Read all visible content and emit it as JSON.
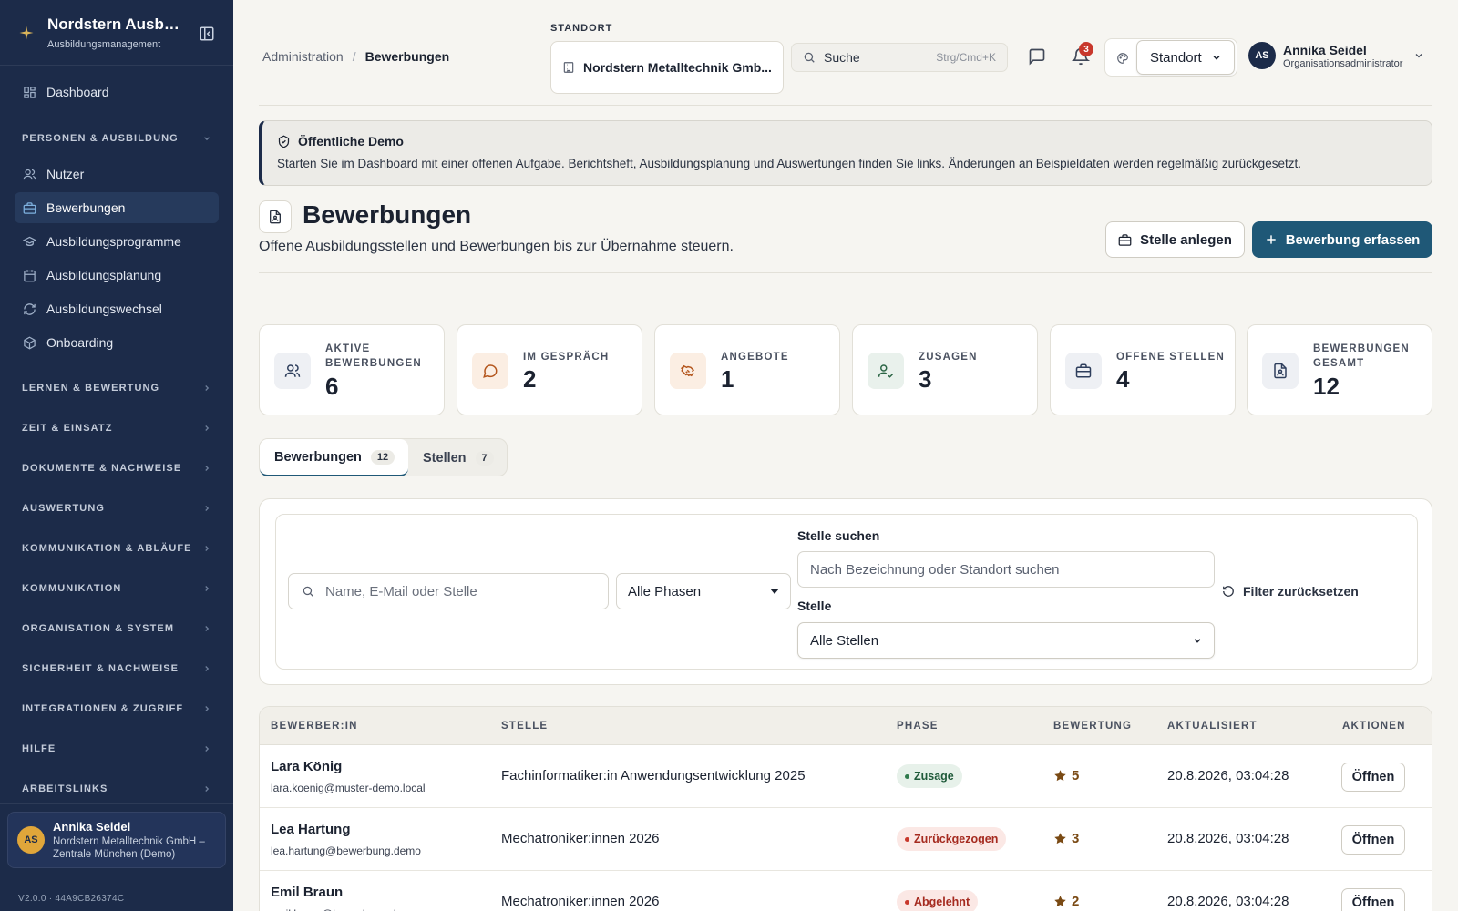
{
  "colors": {
    "sidebar_bg": "#1c2b49",
    "primary": "#1f5877",
    "accent_gold": "#e0a63a",
    "success_pill": "#e7f1ea",
    "danger_pill": "#fbe8e5"
  },
  "sidebar": {
    "brand_title": "Nordstern Ausbil...",
    "brand_subtitle": "Ausbildungsmanagement",
    "dashboard": "Dashboard",
    "group_open": "PERSONEN & AUSBILDUNG",
    "sub_items": [
      {
        "label": "Nutzer",
        "icon": "users-icon"
      },
      {
        "label": "Bewerbungen",
        "icon": "briefcase-icon",
        "active": true
      },
      {
        "label": "Ausbildungsprogramme",
        "icon": "graduation-cap-icon"
      },
      {
        "label": "Ausbildungsplanung",
        "icon": "calendar-icon"
      },
      {
        "label": "Ausbildungswechsel",
        "icon": "refresh-icon"
      },
      {
        "label": "Onboarding",
        "icon": "package-icon"
      }
    ],
    "groups": [
      "LERNEN & BEWERTUNG",
      "ZEIT & EINSATZ",
      "DOKUMENTE & NACHWEISE",
      "AUSWERTUNG",
      "KOMMUNIKATION & ABLÄUFE",
      "KOMMUNIKATION",
      "ORGANISATION & SYSTEM",
      "SICHERHEIT & NACHWEISE",
      "INTEGRATIONEN & ZUGRIFF",
      "HILFE",
      "ARBEITSLINKS"
    ],
    "user": {
      "initials": "AS",
      "name": "Annika Seidel",
      "org_line1": "Nordstern Metalltechnik GmbH –",
      "org_line2": "Zentrale München (Demo)"
    },
    "version": "V2.0.0 · 44A9CB26374C"
  },
  "header": {
    "breadcrumb": [
      "Administration",
      "Bewerbungen"
    ],
    "breadcrumb_sep": "/",
    "standort_label": "STANDORT",
    "standort_value": "Nordstern Metalltechnik Gmb...",
    "search_placeholder": "Suche",
    "search_shortcut": "Strg/Cmd+K",
    "notification_count": "3",
    "theme_select": "Standort",
    "user": {
      "initials": "AS",
      "name": "Annika Seidel",
      "role": "Organisationsadministrator"
    }
  },
  "notice": {
    "title": "Öffentliche Demo",
    "text": "Starten Sie im Dashboard mit einer offenen Aufgabe. Berichtsheft, Ausbildungsplanung und Auswertungen finden Sie links. Änderungen an Beispieldaten werden regelmäßig zurückgesetzt."
  },
  "page": {
    "title": "Bewerbungen",
    "subtitle": "Offene Ausbildungsstellen und Bewerbungen bis zur Übernahme steuern.",
    "btn_secondary": "Stelle anlegen",
    "btn_primary": "Bewerbung erfassen"
  },
  "stats": [
    {
      "l1": "AKTIVE",
      "l2": "BEWERBUNGEN",
      "value": "6",
      "icon": "users-icon",
      "tone": "slate"
    },
    {
      "l1": "IM GESPRÄCH",
      "l2": "",
      "value": "2",
      "icon": "message-icon",
      "tone": "orange"
    },
    {
      "l1": "ANGEBOTE",
      "l2": "",
      "value": "1",
      "icon": "handshake-icon",
      "tone": "orange"
    },
    {
      "l1": "ZUSAGEN",
      "l2": "",
      "value": "3",
      "icon": "user-check-icon",
      "tone": "green"
    },
    {
      "l1": "OFFENE STELLEN",
      "l2": "",
      "value": "4",
      "icon": "briefcase-icon",
      "tone": "slate"
    },
    {
      "l1": "BEWERBUNGEN",
      "l2": "GESAMT",
      "value": "12",
      "icon": "file-user-icon",
      "tone": "slate"
    }
  ],
  "tabs": [
    {
      "label": "Bewerbungen",
      "count": "12",
      "active": true
    },
    {
      "label": "Stellen",
      "count": "7",
      "active": false
    }
  ],
  "filters": {
    "search_placeholder": "Name, E-Mail oder Stelle",
    "phase_value": "Alle Phasen",
    "stelle_search_label": "Stelle suchen",
    "stelle_search_placeholder": "Nach Bezeichnung oder Standort suchen",
    "stelle_label": "Stelle",
    "stelle_value": "Alle Stellen",
    "reset": "Filter zurücksetzen"
  },
  "table": {
    "headers": [
      "BEWERBER:IN",
      "STELLE",
      "PHASE",
      "BEWERTUNG",
      "AKTUALISIERT",
      "AKTIONEN"
    ],
    "rows": [
      {
        "name": "Lara König",
        "email": "lara.koenig@muster-demo.local",
        "stelle": "Fachinformatiker:in Anwendungsentwicklung 2025",
        "phase": "Zusage",
        "phase_tone": "success",
        "rating": "5",
        "updated": "20.8.2026, 03:04:28",
        "action": "Öffnen"
      },
      {
        "name": "Lea Hartung",
        "email": "lea.hartung@bewerbung.demo",
        "stelle": "Mechatroniker:innen 2026",
        "phase": "Zurückgezogen",
        "phase_tone": "danger",
        "rating": "3",
        "updated": "20.8.2026, 03:04:28",
        "action": "Öffnen"
      },
      {
        "name": "Emil Braun",
        "email": "emil.braun@bewerbung.demo",
        "stelle": "Mechatroniker:innen 2026",
        "phase": "Abgelehnt",
        "phase_tone": "danger",
        "rating": "2",
        "updated": "20.8.2026, 03:04:28",
        "action": "Öffnen"
      }
    ]
  }
}
